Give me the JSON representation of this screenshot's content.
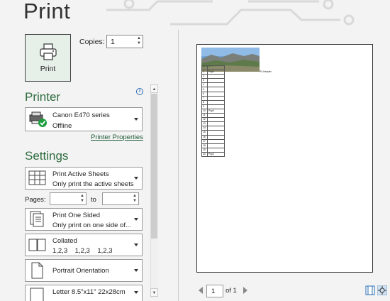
{
  "header": {
    "title": "Print"
  },
  "print_button": {
    "label": "Print",
    "icon": "printer-icon"
  },
  "copies": {
    "label": "Copies:",
    "value": "1"
  },
  "printer": {
    "section_title": "Printer",
    "name": "Canon E470 series",
    "status": "Offline",
    "properties_link": "Printer Properties"
  },
  "settings": {
    "section_title": "Settings",
    "scope": {
      "line1": "Print Active Sheets",
      "line2": "Only print the active sheets"
    },
    "pages": {
      "label": "Pages:",
      "from": "",
      "to_label": "to",
      "to": ""
    },
    "sides": {
      "line1": "Print One Sided",
      "line2": "Only print on one side of..."
    },
    "collation": {
      "line1": "Collated",
      "line2": "1,2,3    1,2,3    1,2,3"
    },
    "orientation": {
      "line1": "Portrait Orientation"
    },
    "paper": {
      "line1": "Letter 8.5\"x11\" 22x28cm"
    }
  },
  "preview": {
    "caption": "P4 Header",
    "table_rows": [
      {
        "n": "",
        "v": ""
      },
      {
        "n": "1",
        "v": "Pupil"
      },
      {
        "n": "2",
        "v": ""
      },
      {
        "n": "3",
        "v": ""
      },
      {
        "n": "4",
        "v": ""
      },
      {
        "n": "5",
        "v": ""
      },
      {
        "n": "6",
        "v": ""
      },
      {
        "n": "7",
        "v": ""
      },
      {
        "n": "8",
        "v": ""
      },
      {
        "n": "9",
        "v": ""
      },
      {
        "n": "10",
        "v": "Pupil"
      },
      {
        "n": "11",
        "v": ""
      },
      {
        "n": "12",
        "v": ""
      },
      {
        "n": "13",
        "v": ""
      },
      {
        "n": "14",
        "v": ""
      },
      {
        "n": "15",
        "v": ""
      },
      {
        "n": "16",
        "v": ""
      },
      {
        "n": "17",
        "v": ""
      },
      {
        "n": "18",
        "v": ""
      },
      {
        "n": "19",
        "v": ""
      },
      {
        "n": "20",
        "v": "Pupil"
      }
    ]
  },
  "pager": {
    "current": "1",
    "of_label": "of 1"
  },
  "colors": {
    "accent": "#2e6b3e",
    "link": "#1f5c36",
    "status_ok": "#1e9e3e"
  }
}
